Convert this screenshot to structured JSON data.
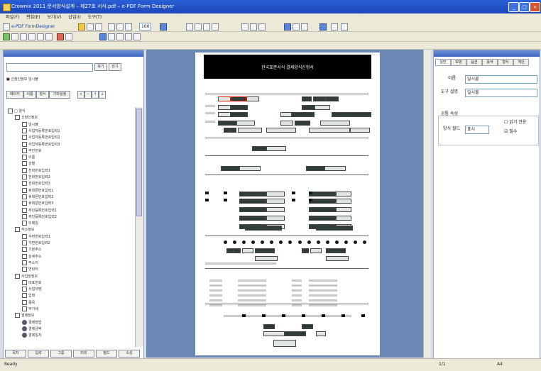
{
  "window": {
    "title": "Crownix 2011 문서양식설계 – 제27호 서식.pdf – e-PDF Form Designer"
  },
  "menu": [
    "파일(F)",
    "편집(E)",
    "보기(V)",
    "삽입(I)",
    "도구(T)"
  ],
  "toolbar": {
    "product_label": "e-PDF FormDesigner",
    "zoom_value": "100"
  },
  "left_panel": {
    "search_label": "찾기",
    "search_btn": "찾기",
    "close_btn": "닫기",
    "path_text": "■ 신청인정보 일시불",
    "view_buttons": [
      "페이지",
      "이름",
      "형식",
      "기타설정"
    ],
    "tree_items": [
      "□ 양식",
      "신청인정보",
      "일시불",
      "사업자등록번호입력1",
      "사업자등록번호입력2",
      "사업자등록번호입력3",
      "주민번호",
      "이름",
      "성별",
      "전화번호입력1",
      "전화번호입력2",
      "전화번호입력3",
      "휴대폰번호입력1",
      "휴대폰번호입력2",
      "휴대폰번호입력3",
      "주민등록번호입력1",
      "주민등록번호입력2",
      "이메일",
      "주소정보",
      "우편번호입력1",
      "우편번호입력2",
      "기본주소",
      "상세주소",
      "주소지",
      "연락처",
      "사업장정보",
      "대표번호",
      "사업자명",
      "업태",
      "종목",
      "부가세",
      "결제정보",
      "결제방법",
      "결제금액",
      "결제일자"
    ],
    "bottom_tabs": [
      "목차",
      "입력",
      "그룹",
      "미리",
      "필드",
      "속성"
    ]
  },
  "document": {
    "banner_title": "한국표준서식 결제양식신청서"
  },
  "right_panel": {
    "tabs": [
      "일반",
      "모양",
      "옵션",
      "동작",
      "형식",
      "계산"
    ],
    "name_label": "이름",
    "name_value": "일시불",
    "tooltip_label": "도구 설명",
    "tooltip_value": "일시불",
    "common_props_label": "공통 속성",
    "form_field_label": "양식 필드",
    "form_field_value": "표시",
    "readonly_label": "읽기 전용",
    "required_label": "필수"
  },
  "status": {
    "left": "Ready",
    "page": "1/1",
    "zoom_short": "A4"
  }
}
